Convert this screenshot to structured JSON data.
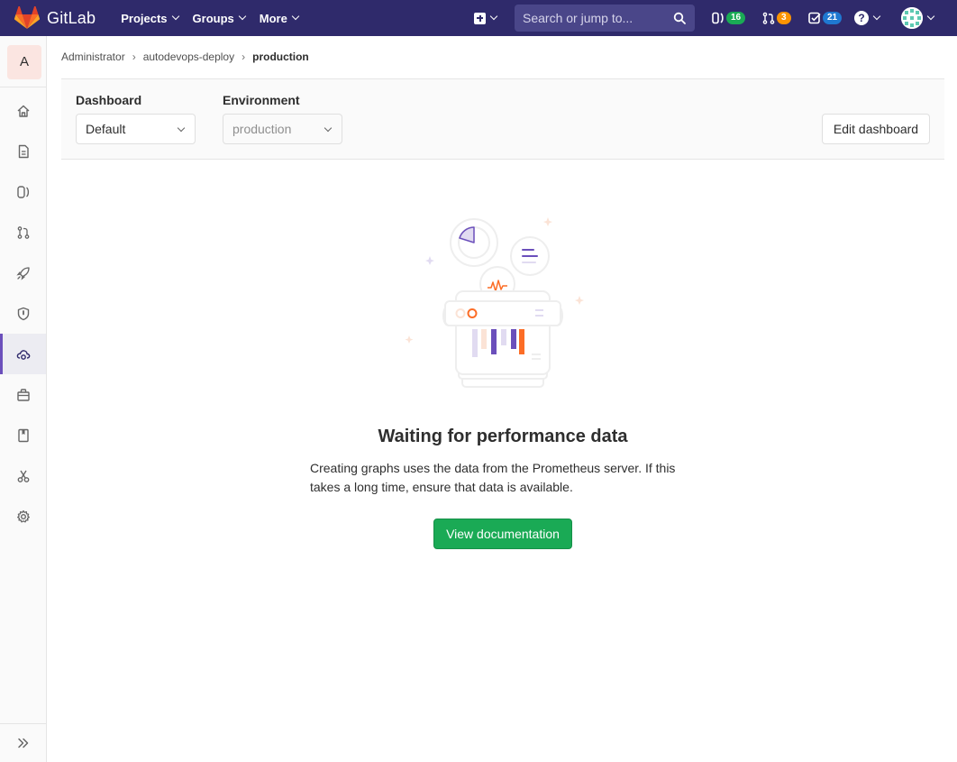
{
  "header": {
    "brand": "GitLab",
    "menu": [
      {
        "label": "Projects"
      },
      {
        "label": "Groups"
      },
      {
        "label": "More"
      }
    ],
    "search_placeholder": "Search or jump to...",
    "counters": {
      "issues": "16",
      "merge_requests": "3",
      "todos": "21"
    },
    "help_glyph": "?"
  },
  "sidebar": {
    "project_initial": "A",
    "items": [
      {
        "icon": "home-icon"
      },
      {
        "icon": "repository-icon"
      },
      {
        "icon": "issues-icon"
      },
      {
        "icon": "merge-request-icon"
      },
      {
        "icon": "rocket-icon"
      },
      {
        "icon": "shield-icon"
      },
      {
        "icon": "cloud-gear-icon",
        "active": true
      },
      {
        "icon": "package-icon"
      },
      {
        "icon": "book-icon"
      },
      {
        "icon": "snippets-icon"
      },
      {
        "icon": "settings-icon"
      }
    ],
    "collapse_icon": "double-chevron-right-icon"
  },
  "breadcrumb": {
    "items": [
      "Administrator",
      "autodevops-deploy"
    ],
    "current": "production"
  },
  "controls": {
    "dashboard_label": "Dashboard",
    "dashboard_value": "Default",
    "environment_label": "Environment",
    "environment_value": "production",
    "edit_label": "Edit dashboard"
  },
  "empty_state": {
    "title": "Waiting for performance data",
    "description": "Creating graphs uses the data from the Prometheus server. If this takes a long time, ensure that data is available.",
    "button": "View documentation"
  },
  "colors": {
    "navbar": "#2f2a6b",
    "accent": "#6b4fbb",
    "success": "#1aaa55",
    "warning": "#fc9403",
    "info": "#1f78d1"
  }
}
